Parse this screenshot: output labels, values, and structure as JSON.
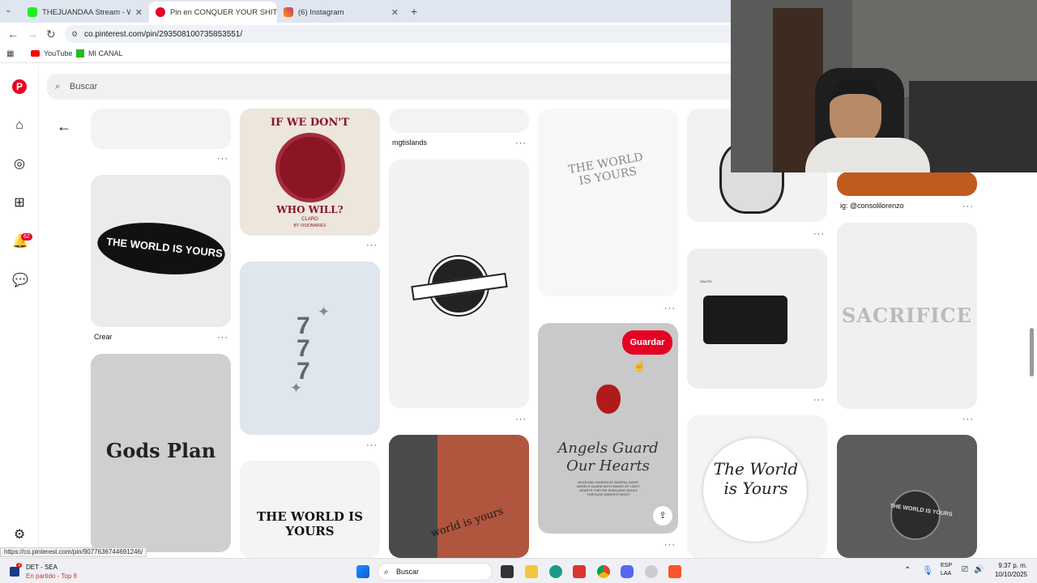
{
  "browser": {
    "tabs": [
      {
        "title": "THEJUANDAA Stream - Watch L",
        "close": "✕"
      },
      {
        "title": "Pin en CONQUER YOUR SHIT",
        "close": "✕"
      },
      {
        "title": "(6) Instagram",
        "close": "✕"
      }
    ],
    "new_tab": "+",
    "url": "co.pinterest.com/pin/293508100735853551/",
    "bookmarks": [
      "YouTube",
      "MI CANAL"
    ]
  },
  "pinterest": {
    "search_placeholder": "Buscar",
    "notification_count": "62",
    "save_label": "Guardar"
  },
  "pins": {
    "p1_text": "THE WORLD IS YOURS",
    "p2_top": "IF WE DON'T",
    "p2_bottom": "WHO WILL?",
    "p2_brand": "CLARO",
    "p2_brand_sub": "BY VISIONARIES",
    "p3_text": "777",
    "p4_text": "Gods Plan",
    "p5_text": "THE WORLD IS YOURS",
    "p6_text": "world is yours",
    "p7_text": "THE WORLD IS YOURS",
    "p8_title1": "Angels Guard",
    "p8_title2": "Our Hearts",
    "p8_small": "INVOLVED UNSEEN BY MORTAL SIGHT, ANGELS GUARD WITH WINGS OF LIGHT, HEARTS THEY'RE SHIELDING SOULS THROUGH DARKEST NIGHT",
    "p9_text": "SACRIFICE",
    "p10_text": "The World is Yours",
    "p11_text": "THE WORLD IS YOURS",
    "car_sign": "GALITO"
  },
  "captions": {
    "crear": "Crear",
    "mgtislands": "mgtislands",
    "consolil": "ig: @consolilorenzo"
  },
  "more": "···",
  "status_url": "https://co.pinterest.com/pin/907763674469124​6/",
  "taskbar": {
    "weather_title": "DET - SEA",
    "weather_sub": "En partido - Top 8",
    "badge": "3",
    "search": "Buscar",
    "lang1": "ESP",
    "lang2": "LAA",
    "time": "9:37 p. m.",
    "date": "10/10/2025"
  },
  "colors": {
    "pinterest_red": "#e60023",
    "tab_bg": "#dfe6f0"
  }
}
